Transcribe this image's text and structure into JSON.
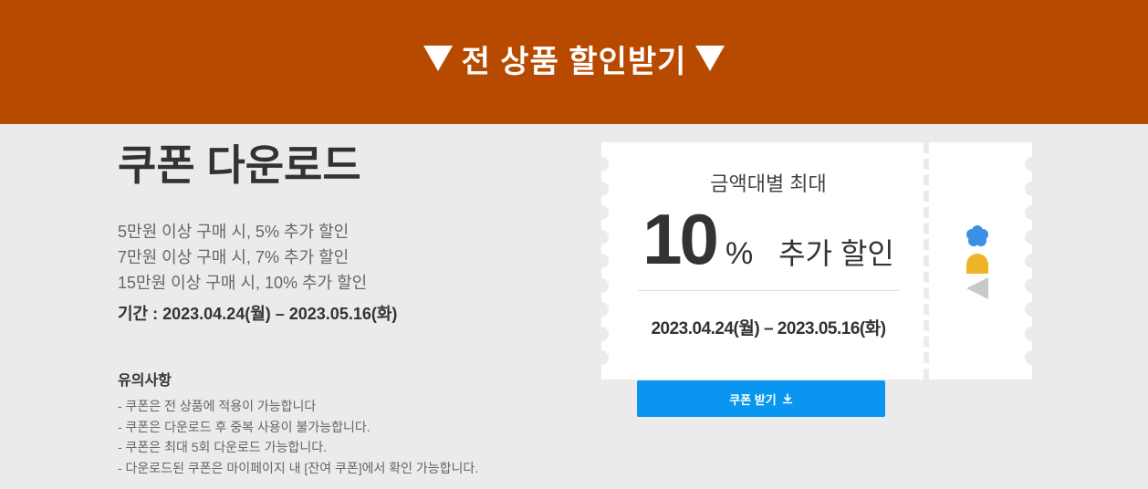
{
  "banner": {
    "title": "전 상품 할인받기",
    "left_icon": "triangle-down-icon",
    "right_icon": "triangle-down-icon",
    "background_color": "#b84a00"
  },
  "coupon": {
    "heading": "쿠폰 다운로드",
    "conditions": [
      "5만원 이상 구매 시, 5% 추가 할인",
      "7만원 이상 구매 시, 7% 추가 할인",
      "15만원 이상 구매 시, 10% 추가 할인"
    ],
    "period_text": "기간 : 2023.04.24(월) – 2023.05.16(화)"
  },
  "notice": {
    "title": "유의사항",
    "items": [
      "- 쿠폰은 전 상품에 적용이 가능합니다",
      "- 쿠폰은 다운로드 후 중복 사용이 불가능합니다.",
      "- 쿠폰은 최대 5회 다운로드 가능합니다.",
      "- 다운로드된 쿠폰은 마이페이지 내 [잔여 쿠폰]에서 확인 가능합니다."
    ]
  },
  "ticket": {
    "subtitle": "금액대별 최대",
    "value": "10",
    "percent_sign": "%",
    "extra_label": "추가 할인",
    "period": "2023.04.24(월) – 2023.05.16(화)",
    "logo_icon": "brand-logo-icon"
  },
  "download_button": {
    "label": "쿠폰 받기",
    "icon": "download-icon",
    "color": "#0a96f0"
  }
}
